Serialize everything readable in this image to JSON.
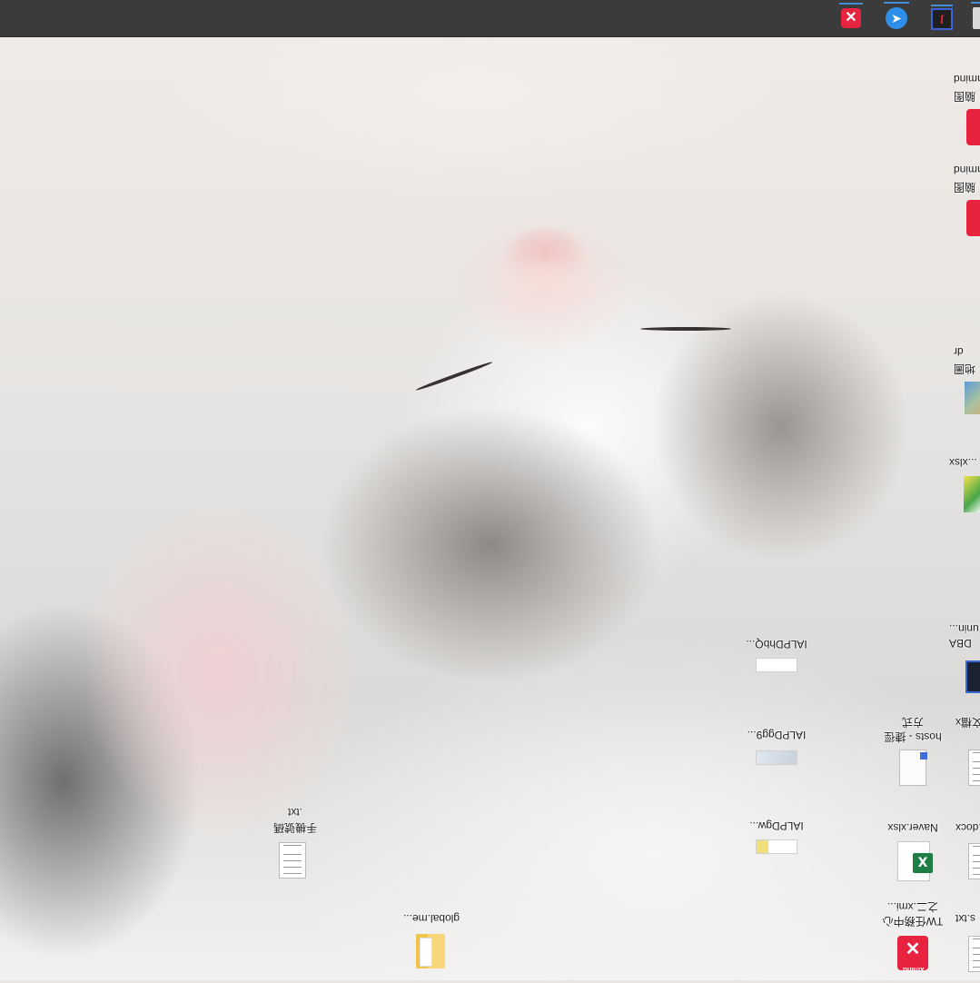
{
  "taskbar": {
    "tray_icons": [
      "xmind-icon",
      "feather-app-icon",
      "app-icon",
      "window-edge-icon"
    ]
  },
  "desktop": {
    "items": [
      {
        "name": "global-me-folder",
        "label": "global.me...",
        "icon": "folder-icon"
      },
      {
        "name": "txt-file-1",
        "label_line1": "手機號碼",
        "label_line2": ".txt",
        "icon": "text-file-icon"
      },
      {
        "name": "ialpdgw-image",
        "label": "IALPDgw...",
        "icon": "image-thumbnail-icon"
      },
      {
        "name": "ialpdggp-image",
        "label": "IALPDgg9...",
        "icon": "image-thumbnail-icon"
      },
      {
        "name": "ialpdhbq-image",
        "label": "IALPDhbQ...",
        "icon": "image-thumbnail-icon"
      },
      {
        "name": "naver-xlsx",
        "label": "Naver.xlsx",
        "icon": "excel-icon"
      },
      {
        "name": "hosts-file",
        "label_line1": "hosts - 捷徑",
        "label_line2": "方式",
        "icon": "shortcut-file-icon"
      },
      {
        "name": "xmind-task",
        "label_line1": "TW任務中心",
        "label_line2": "之二.xmi...",
        "icon": "xmind-icon"
      },
      {
        "name": "partial-txt-1",
        "label": "s.txt",
        "icon": "text-file-icon"
      },
      {
        "name": "partial-docx",
        "label": "o.docx",
        "icon": "text-file-icon"
      },
      {
        "name": "partial-doc-2",
        "label": "文檔x",
        "icon": "text-file-icon"
      },
      {
        "name": "partial-dbA",
        "label_line1": "DBA",
        "label_line2": "unin...",
        "icon": "dark-app-icon"
      },
      {
        "name": "partial-xlsx-2",
        "label": "...xlsx",
        "icon": "chart-icon"
      },
      {
        "name": "partial-map",
        "label_line1": "dr",
        "label_line2": "地圖",
        "icon": "map-icon"
      },
      {
        "name": "partial-xmind-2",
        "label_line1": "hmind",
        "label_line2": "脑图",
        "icon": "xmind-icon"
      },
      {
        "name": "partial-xmind-3",
        "label_line1": "hmind",
        "label_line2": "脑图",
        "icon": "xmind-icon"
      }
    ]
  }
}
